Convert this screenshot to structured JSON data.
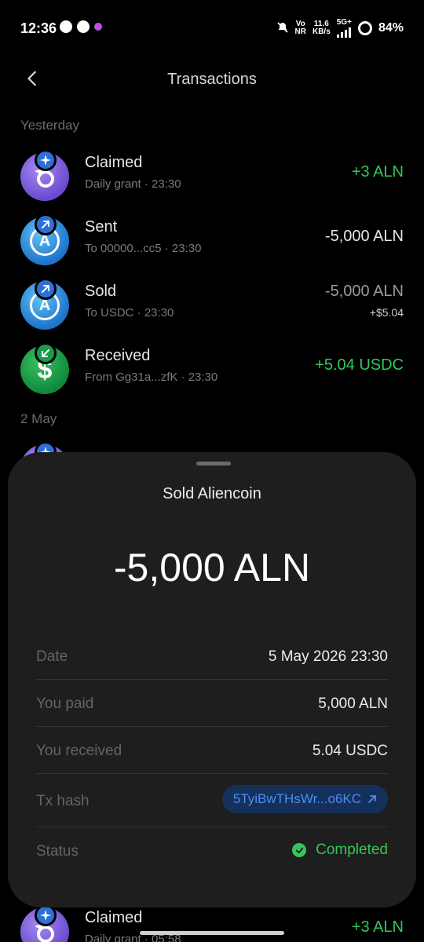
{
  "status_bar": {
    "time": "12:36",
    "net_top": "Vo",
    "net_bottom": "NR",
    "speed_top": "11.6",
    "speed_bottom": "KB/s",
    "signal": "5G+",
    "battery": "84%"
  },
  "header": {
    "title": "Transactions"
  },
  "sections": {
    "yesterday": "Yesterday",
    "may2": "2 May"
  },
  "transactions": [
    {
      "title": "Claimed",
      "subtitle": "Daily grant · 23:30",
      "amount": "+3 ALN"
    },
    {
      "title": "Sent",
      "subtitle": "To 00000...cc5 · 23:30",
      "amount": "-5,000 ALN"
    },
    {
      "title": "Sold",
      "subtitle": "To USDC · 23:30",
      "amount": "-5,000 ALN",
      "amount2": "+$5.04"
    },
    {
      "title": "Received",
      "subtitle": "From Gg31a...zfK · 23:30",
      "amount": "+5.04 USDC"
    }
  ],
  "bottom_tx": {
    "title": "Claimed",
    "subtitle": "Daily grant · 05:58",
    "amount": "+3 ALN"
  },
  "sheet": {
    "title": "Sold Aliencoin",
    "amount": "-5,000 ALN",
    "rows": {
      "date_label": "Date",
      "date_value": "5 May 2026 23:30",
      "paid_label": "You paid",
      "paid_value": "5,000 ALN",
      "received_label": "You received",
      "received_value": "5.04 USDC",
      "hash_label": "Tx hash",
      "hash_value": "5TyiBwTHsWr...o6KC",
      "status_label": "Status",
      "status_value": "Completed"
    }
  },
  "colors": {
    "positive": "#34c759",
    "link": "#4b8ff0",
    "sheet_bg": "#1e1e1e"
  }
}
